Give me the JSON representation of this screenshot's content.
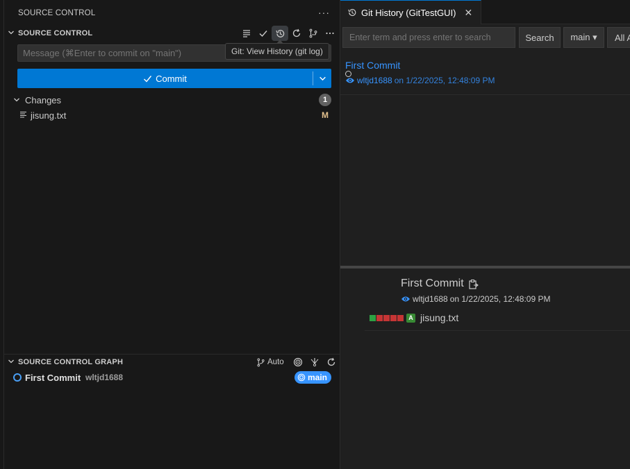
{
  "sidebar": {
    "view_title": "SOURCE CONTROL",
    "more_label": "···",
    "section_title": "SOURCE CONTROL",
    "tooltip": "Git: View History (git log)",
    "message_placeholder": "Message (⌘Enter to commit on \"main\")",
    "commit_label": "Commit",
    "changes": {
      "label": "Changes",
      "count": "1",
      "files": [
        {
          "name": "jisung.txt",
          "status": "M"
        }
      ]
    },
    "graph": {
      "section_title": "SOURCE CONTROL GRAPH",
      "auto_label": "Auto",
      "commit_title": "First Commit",
      "commit_author": "wltjd1688",
      "branch": "main"
    }
  },
  "editor": {
    "tab_title": "Git History (GitTestGUI)",
    "search_placeholder": "Enter term and press enter to search",
    "search_button": "Search",
    "branch_button": "main ▾",
    "all_button": "All A",
    "entry": {
      "title": "First Commit",
      "author": "wltjd1688",
      "date_text": "on 1/22/2025, 12:48:09 PM"
    },
    "detail": {
      "title": "First Commit",
      "author": "wltjd1688",
      "date_text": "on 1/22/2025, 12:48:09 PM",
      "file": {
        "name": "jisung.txt",
        "status": "A"
      }
    }
  },
  "colors": {
    "accent": "#0078d4",
    "link": "#3794ff",
    "modified": "#e2c08d",
    "added": "#388a34",
    "diff_add": "#2ea043",
    "diff_del": "#c53535"
  }
}
